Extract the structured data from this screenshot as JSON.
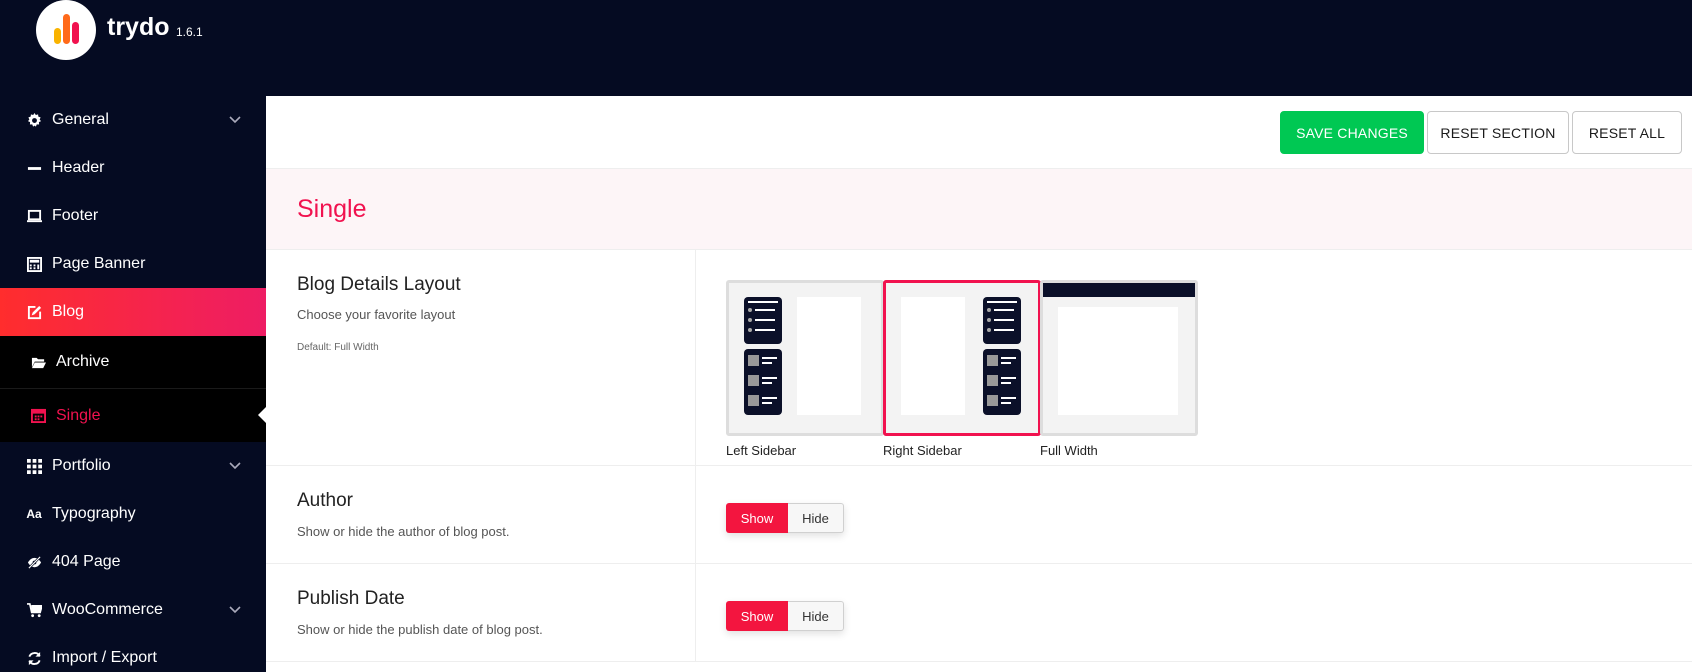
{
  "app": {
    "brand": "trydo",
    "version": "1.6.1",
    "colors": {
      "dark": "#050b22",
      "accent": "#f1124f",
      "save": "#00c853"
    }
  },
  "sidebar": {
    "items": [
      {
        "label": "General",
        "icon": "gear-icon",
        "has_submenu": true
      },
      {
        "label": "Header",
        "icon": "minus-icon"
      },
      {
        "label": "Footer",
        "icon": "laptop-icon"
      },
      {
        "label": "Page Banner",
        "icon": "calculator-icon"
      },
      {
        "label": "Blog",
        "icon": "edit-icon",
        "active": true
      },
      {
        "label": "Portfolio",
        "icon": "grid-icon",
        "has_submenu": true
      },
      {
        "label": "Typography",
        "icon": "font-icon"
      },
      {
        "label": "404 Page",
        "icon": "eye-slash-icon"
      },
      {
        "label": "WooCommerce",
        "icon": "cart-icon",
        "has_submenu": true
      },
      {
        "label": "Import / Export",
        "icon": "refresh-icon"
      }
    ],
    "blog_submenu": [
      {
        "label": "Archive",
        "icon": "folder-open-icon"
      },
      {
        "label": "Single",
        "icon": "calendar-icon",
        "current": true
      }
    ]
  },
  "toolbar": {
    "save_label": "SAVE CHANGES",
    "reset_section_label": "RESET SECTION",
    "reset_all_label": "RESET ALL"
  },
  "section": {
    "title": "Single"
  },
  "fields": {
    "layout": {
      "title": "Blog Details Layout",
      "description": "Choose your favorite layout",
      "default": "Default: Full Width",
      "options": [
        {
          "label": "Left Sidebar"
        },
        {
          "label": "Right Sidebar",
          "selected": true
        },
        {
          "label": "Full Width"
        }
      ]
    },
    "author": {
      "title": "Author",
      "description": "Show or hide the author of blog post.",
      "show_label": "Show",
      "hide_label": "Hide",
      "value": "Show"
    },
    "publish_date": {
      "title": "Publish Date",
      "description": "Show or hide the publish date of blog post.",
      "show_label": "Show",
      "hide_label": "Hide",
      "value": "Show"
    }
  }
}
